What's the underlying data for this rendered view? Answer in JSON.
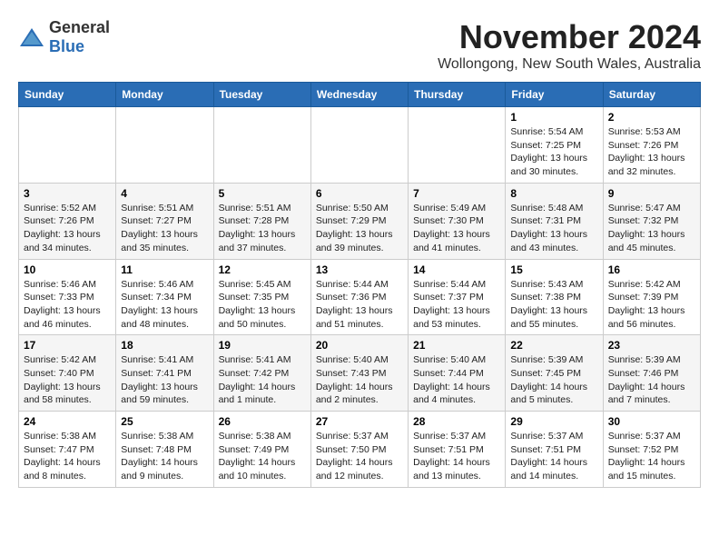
{
  "logo": {
    "general": "General",
    "blue": "Blue"
  },
  "title": {
    "month": "November 2024",
    "location": "Wollongong, New South Wales, Australia"
  },
  "weekdays": [
    "Sunday",
    "Monday",
    "Tuesday",
    "Wednesday",
    "Thursday",
    "Friday",
    "Saturday"
  ],
  "weeks": [
    [
      {
        "day": "",
        "info": ""
      },
      {
        "day": "",
        "info": ""
      },
      {
        "day": "",
        "info": ""
      },
      {
        "day": "",
        "info": ""
      },
      {
        "day": "",
        "info": ""
      },
      {
        "day": "1",
        "info": "Sunrise: 5:54 AM\nSunset: 7:25 PM\nDaylight: 13 hours\nand 30 minutes."
      },
      {
        "day": "2",
        "info": "Sunrise: 5:53 AM\nSunset: 7:26 PM\nDaylight: 13 hours\nand 32 minutes."
      }
    ],
    [
      {
        "day": "3",
        "info": "Sunrise: 5:52 AM\nSunset: 7:26 PM\nDaylight: 13 hours\nand 34 minutes."
      },
      {
        "day": "4",
        "info": "Sunrise: 5:51 AM\nSunset: 7:27 PM\nDaylight: 13 hours\nand 35 minutes."
      },
      {
        "day": "5",
        "info": "Sunrise: 5:51 AM\nSunset: 7:28 PM\nDaylight: 13 hours\nand 37 minutes."
      },
      {
        "day": "6",
        "info": "Sunrise: 5:50 AM\nSunset: 7:29 PM\nDaylight: 13 hours\nand 39 minutes."
      },
      {
        "day": "7",
        "info": "Sunrise: 5:49 AM\nSunset: 7:30 PM\nDaylight: 13 hours\nand 41 minutes."
      },
      {
        "day": "8",
        "info": "Sunrise: 5:48 AM\nSunset: 7:31 PM\nDaylight: 13 hours\nand 43 minutes."
      },
      {
        "day": "9",
        "info": "Sunrise: 5:47 AM\nSunset: 7:32 PM\nDaylight: 13 hours\nand 45 minutes."
      }
    ],
    [
      {
        "day": "10",
        "info": "Sunrise: 5:46 AM\nSunset: 7:33 PM\nDaylight: 13 hours\nand 46 minutes."
      },
      {
        "day": "11",
        "info": "Sunrise: 5:46 AM\nSunset: 7:34 PM\nDaylight: 13 hours\nand 48 minutes."
      },
      {
        "day": "12",
        "info": "Sunrise: 5:45 AM\nSunset: 7:35 PM\nDaylight: 13 hours\nand 50 minutes."
      },
      {
        "day": "13",
        "info": "Sunrise: 5:44 AM\nSunset: 7:36 PM\nDaylight: 13 hours\nand 51 minutes."
      },
      {
        "day": "14",
        "info": "Sunrise: 5:44 AM\nSunset: 7:37 PM\nDaylight: 13 hours\nand 53 minutes."
      },
      {
        "day": "15",
        "info": "Sunrise: 5:43 AM\nSunset: 7:38 PM\nDaylight: 13 hours\nand 55 minutes."
      },
      {
        "day": "16",
        "info": "Sunrise: 5:42 AM\nSunset: 7:39 PM\nDaylight: 13 hours\nand 56 minutes."
      }
    ],
    [
      {
        "day": "17",
        "info": "Sunrise: 5:42 AM\nSunset: 7:40 PM\nDaylight: 13 hours\nand 58 minutes."
      },
      {
        "day": "18",
        "info": "Sunrise: 5:41 AM\nSunset: 7:41 PM\nDaylight: 13 hours\nand 59 minutes."
      },
      {
        "day": "19",
        "info": "Sunrise: 5:41 AM\nSunset: 7:42 PM\nDaylight: 14 hours\nand 1 minute."
      },
      {
        "day": "20",
        "info": "Sunrise: 5:40 AM\nSunset: 7:43 PM\nDaylight: 14 hours\nand 2 minutes."
      },
      {
        "day": "21",
        "info": "Sunrise: 5:40 AM\nSunset: 7:44 PM\nDaylight: 14 hours\nand 4 minutes."
      },
      {
        "day": "22",
        "info": "Sunrise: 5:39 AM\nSunset: 7:45 PM\nDaylight: 14 hours\nand 5 minutes."
      },
      {
        "day": "23",
        "info": "Sunrise: 5:39 AM\nSunset: 7:46 PM\nDaylight: 14 hours\nand 7 minutes."
      }
    ],
    [
      {
        "day": "24",
        "info": "Sunrise: 5:38 AM\nSunset: 7:47 PM\nDaylight: 14 hours\nand 8 minutes."
      },
      {
        "day": "25",
        "info": "Sunrise: 5:38 AM\nSunset: 7:48 PM\nDaylight: 14 hours\nand 9 minutes."
      },
      {
        "day": "26",
        "info": "Sunrise: 5:38 AM\nSunset: 7:49 PM\nDaylight: 14 hours\nand 10 minutes."
      },
      {
        "day": "27",
        "info": "Sunrise: 5:37 AM\nSunset: 7:50 PM\nDaylight: 14 hours\nand 12 minutes."
      },
      {
        "day": "28",
        "info": "Sunrise: 5:37 AM\nSunset: 7:51 PM\nDaylight: 14 hours\nand 13 minutes."
      },
      {
        "day": "29",
        "info": "Sunrise: 5:37 AM\nSunset: 7:51 PM\nDaylight: 14 hours\nand 14 minutes."
      },
      {
        "day": "30",
        "info": "Sunrise: 5:37 AM\nSunset: 7:52 PM\nDaylight: 14 hours\nand 15 minutes."
      }
    ]
  ]
}
